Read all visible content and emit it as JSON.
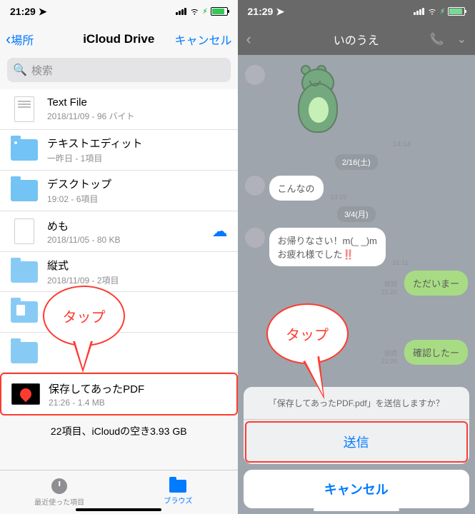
{
  "status": {
    "time": "21:29",
    "locArrow": "➤",
    "battery_pct": 80
  },
  "left": {
    "nav": {
      "back": "場所",
      "title": "iCloud Drive",
      "cancel": "キャンセル"
    },
    "search_placeholder": "検索",
    "items": [
      {
        "name": "Text File",
        "meta": "2018/11/09 - 96 バイト",
        "icon": "doc"
      },
      {
        "name": "テキストエディット",
        "meta": "一昨日 - 1項目",
        "icon": "folder-dot"
      },
      {
        "name": "デスクトップ",
        "meta": "19:02 - 6項目",
        "icon": "folder"
      },
      {
        "name": "めも",
        "meta": "2018/11/05 - 80 KB",
        "icon": "doc",
        "cloud": true
      },
      {
        "name": "縦式",
        "meta": "2018/11/09 - 2項目",
        "icon": "folder"
      },
      {
        "name": "",
        "meta": "",
        "icon": "folder-doc"
      },
      {
        "name": "",
        "meta": "",
        "icon": "folder"
      },
      {
        "name": "保存してあったPDF",
        "meta": "21:26 - 1.4 MB",
        "icon": "pdf",
        "highlight": true
      }
    ],
    "footer": "22項目、iCloudの空き3.93 GB",
    "tabs": {
      "recent": "最近使った項目",
      "browse": "ブラウズ"
    }
  },
  "right": {
    "title": "いのうえ",
    "messages": {
      "t1": "14:14",
      "d1": "2/16(土)",
      "m1": "こんなの",
      "mt1": "13:19",
      "d2": "3/4(月)",
      "m2": "お帰りなさい！m(_ _)m\nお疲れ様でした‼️",
      "mt2": "21:11",
      "m3": "ただいまー",
      "m3read": "既読",
      "m3t": "21:26",
      "m4": "確認したー",
      "m4read": "既読",
      "m4t": "21:26"
    },
    "sheet": {
      "prompt": "「保存してあったPDF.pdf」を送信しますか？",
      "send": "送信",
      "cancel": "キャンセル"
    }
  },
  "callout": "タップ"
}
